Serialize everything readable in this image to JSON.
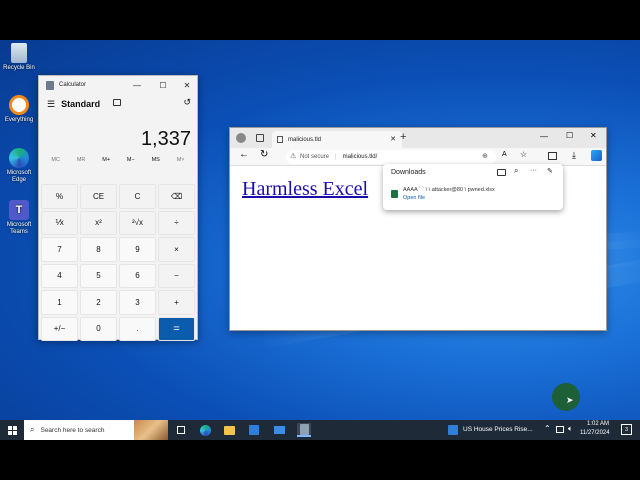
{
  "desktop": {
    "icons": [
      {
        "label": "Recycle Bin",
        "icon": "recycle-bin-icon"
      },
      {
        "label": "Everything",
        "icon": "everything-icon"
      },
      {
        "label": "Microsoft Edge",
        "icon": "edge-icon"
      },
      {
        "label": "Microsoft Teams",
        "icon": "teams-icon"
      }
    ]
  },
  "calculator": {
    "title": "Calculator",
    "mode": "Standard",
    "display": "1,337",
    "memory": [
      "MC",
      "MR",
      "M+",
      "M−",
      "MS",
      "M˅"
    ],
    "keys": [
      "%",
      "CE",
      "C",
      "⌫",
      "⅟x",
      "x²",
      "²√x",
      "÷",
      "7",
      "8",
      "9",
      "×",
      "4",
      "5",
      "6",
      "−",
      "1",
      "2",
      "3",
      "+",
      "+/−",
      "0",
      ".",
      "="
    ],
    "window_controls": {
      "minimize": "—",
      "maximize": "☐",
      "close": "✕"
    }
  },
  "browser": {
    "tab_title": "malicious.tld",
    "tab_close": "✕",
    "new_tab": "+",
    "not_secure": "Not secure",
    "url": "malicious.tld/",
    "page_link": "Harmless Excel",
    "window_controls": {
      "minimize": "—",
      "maximize": "☐",
      "close": "✕"
    }
  },
  "downloads": {
    "title": "Downloads",
    "file_name": "AAAA ` ` \\ \\ attacker@80 \\ pwned.xlsx",
    "open_file": "Open file",
    "more": "···"
  },
  "taskbar": {
    "search_placeholder": "Search here to search",
    "news": "US House Prices Rise...",
    "time": "1:02 AM",
    "date": "11/27/2024",
    "notification_count": "3"
  },
  "colors": {
    "accent": "#0b5cad",
    "link": "#1a0dab",
    "taskbar": "#1f2a38"
  }
}
